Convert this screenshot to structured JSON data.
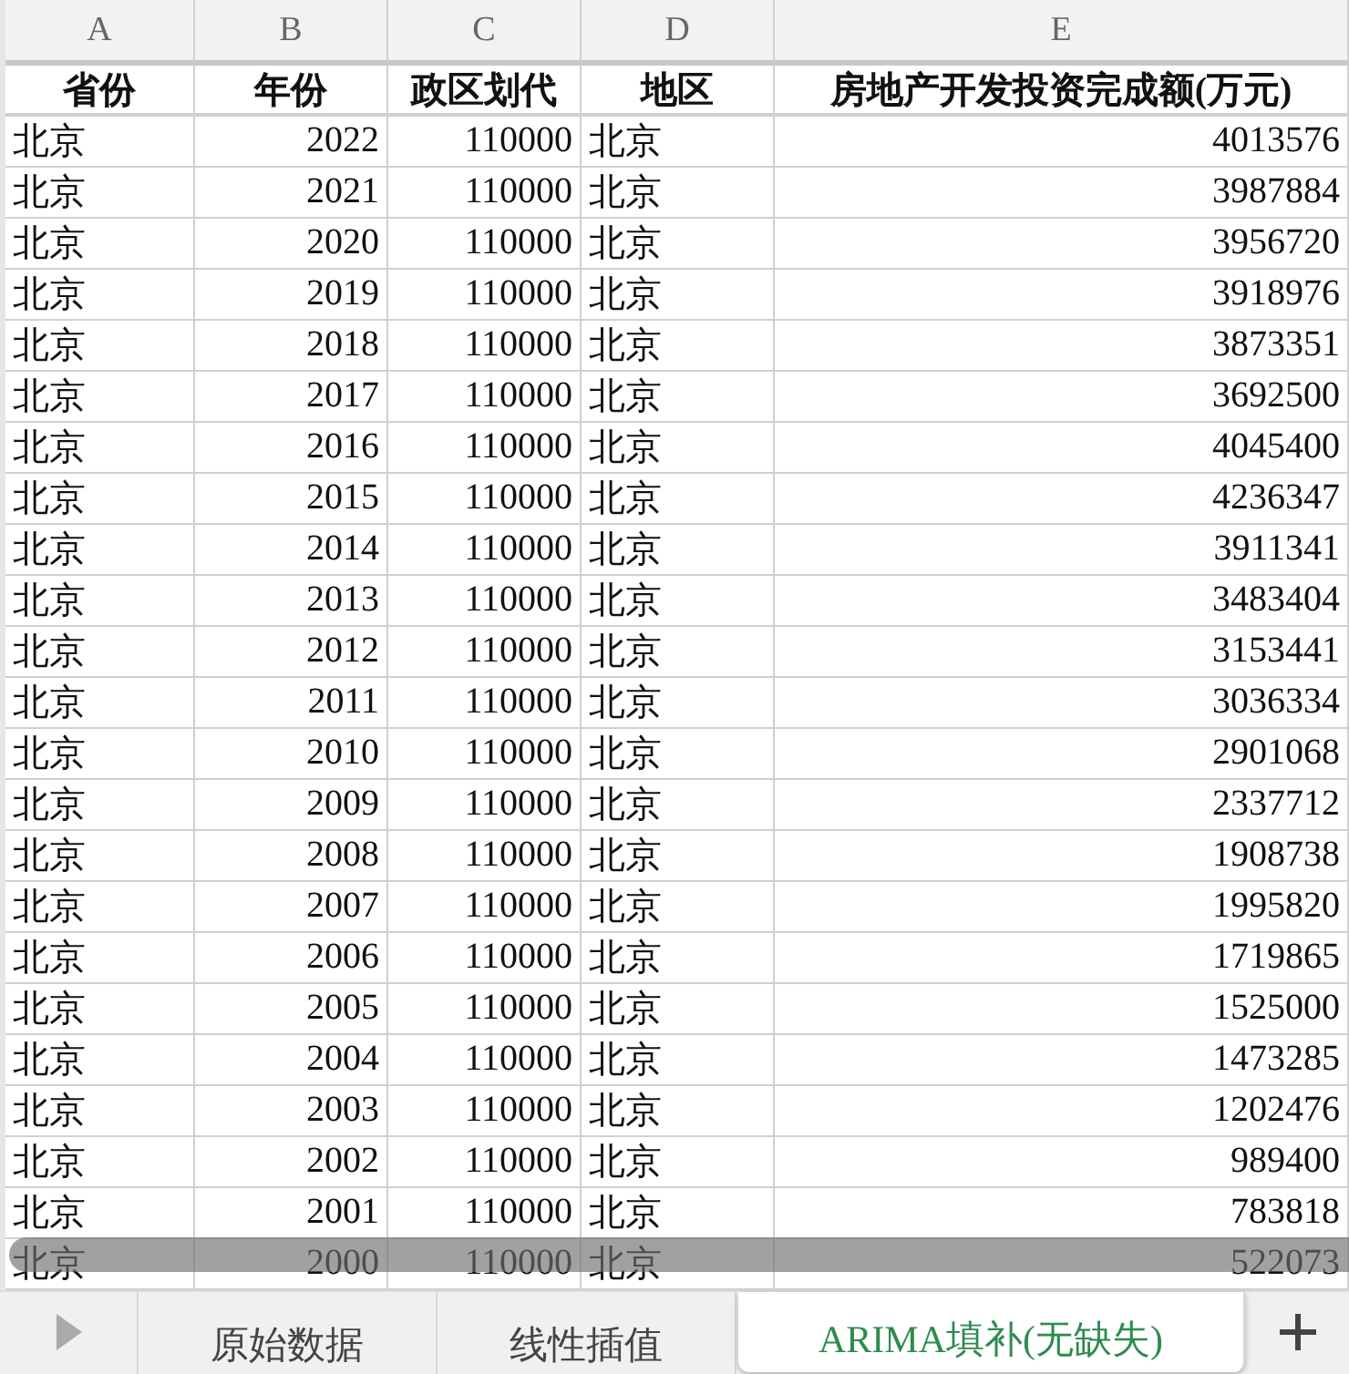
{
  "column_headers": [
    "A",
    "B",
    "C",
    "D",
    "E"
  ],
  "table": {
    "columns": [
      "省份",
      "年份",
      "政区划代",
      "地区",
      "房地产开发投资完成额(万元)"
    ],
    "rows": [
      [
        "北京",
        "2022",
        "110000",
        "北京",
        "4013576"
      ],
      [
        "北京",
        "2021",
        "110000",
        "北京",
        "3987884"
      ],
      [
        "北京",
        "2020",
        "110000",
        "北京",
        "3956720"
      ],
      [
        "北京",
        "2019",
        "110000",
        "北京",
        "3918976"
      ],
      [
        "北京",
        "2018",
        "110000",
        "北京",
        "3873351"
      ],
      [
        "北京",
        "2017",
        "110000",
        "北京",
        "3692500"
      ],
      [
        "北京",
        "2016",
        "110000",
        "北京",
        "4045400"
      ],
      [
        "北京",
        "2015",
        "110000",
        "北京",
        "4236347"
      ],
      [
        "北京",
        "2014",
        "110000",
        "北京",
        "3911341"
      ],
      [
        "北京",
        "2013",
        "110000",
        "北京",
        "3483404"
      ],
      [
        "北京",
        "2012",
        "110000",
        "北京",
        "3153441"
      ],
      [
        "北京",
        "2011",
        "110000",
        "北京",
        "3036334"
      ],
      [
        "北京",
        "2010",
        "110000",
        "北京",
        "2901068"
      ],
      [
        "北京",
        "2009",
        "110000",
        "北京",
        "2337712"
      ],
      [
        "北京",
        "2008",
        "110000",
        "北京",
        "1908738"
      ],
      [
        "北京",
        "2007",
        "110000",
        "北京",
        "1995820"
      ],
      [
        "北京",
        "2006",
        "110000",
        "北京",
        "1719865"
      ],
      [
        "北京",
        "2005",
        "110000",
        "北京",
        "1525000"
      ],
      [
        "北京",
        "2004",
        "110000",
        "北京",
        "1473285"
      ],
      [
        "北京",
        "2003",
        "110000",
        "北京",
        "1202476"
      ],
      [
        "北京",
        "2002",
        "110000",
        "北京",
        "989400"
      ],
      [
        "北京",
        "2001",
        "110000",
        "北京",
        "783818"
      ],
      [
        "北京",
        "2000",
        "110000",
        "北京",
        "522073"
      ]
    ]
  },
  "sheet_tabs": [
    {
      "label": "原始数据",
      "selected": false
    },
    {
      "label": "线性插值",
      "selected": false
    },
    {
      "label": "ARIMA填补(无缺失)",
      "selected": true
    }
  ]
}
